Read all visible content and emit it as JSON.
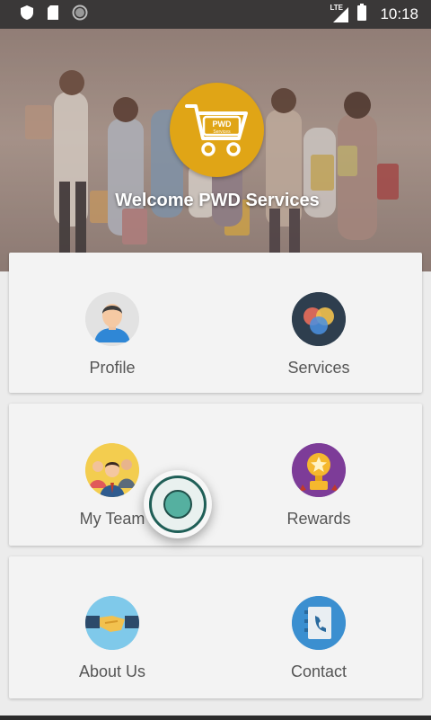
{
  "status_bar": {
    "time": "10:18",
    "network_label": "LTE",
    "left_icons": [
      "shield-icon",
      "sd-card-icon",
      "sync-circle-icon"
    ],
    "right_icons": [
      "signal-icon",
      "battery-icon"
    ]
  },
  "hero": {
    "title": "Welcome PWD Services",
    "logo_text": "PWD",
    "logo_subtext": "Services",
    "accent_color": "#e0a516"
  },
  "menu": {
    "items": [
      {
        "label": "Profile",
        "icon": "profile-avatar-icon"
      },
      {
        "label": "Services",
        "icon": "services-circles-icon"
      },
      {
        "label": "My Team",
        "icon": "team-group-icon"
      },
      {
        "label": "Rewards",
        "icon": "trophy-icon"
      },
      {
        "label": "About Us",
        "icon": "handshake-icon"
      },
      {
        "label": "Contact",
        "icon": "phone-book-icon"
      }
    ]
  },
  "fab": {
    "icon": "floating-action-circle-icon",
    "color": "#55b0a0"
  }
}
